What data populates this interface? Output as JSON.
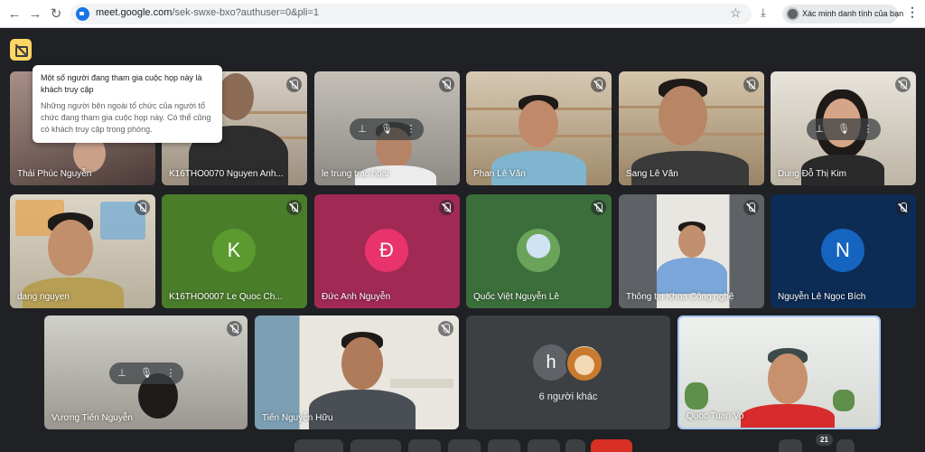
{
  "browser": {
    "url_domain": "meet.google.com",
    "url_path": "/sek-swxe-bxo?authuser=0&pli=1",
    "verify_label": "Xác minh danh tính của bạn",
    "back_icon": "←",
    "forward_icon": "→",
    "reload_icon": "↻",
    "star_icon": "☆",
    "download_icon": "⤓",
    "menu_icon": "⋮"
  },
  "tooltip": {
    "title": "Một số người đang tham gia cuộc họp này là khách truy cập",
    "body": "Những người bên ngoài tổ chức của người tổ chức đang tham gia cuộc họp này. Có thể cũng có khách truy cập trong phòng."
  },
  "participants": [
    {
      "name": "Thái Phúc Nguyễn"
    },
    {
      "name": "K16THO0070 Nguyen Anh..."
    },
    {
      "name": "le trung trac hoai"
    },
    {
      "name": "Phan Lê Văn"
    },
    {
      "name": "Sang Lê Văn"
    },
    {
      "name": "Dung Đỗ Thị Kim"
    },
    {
      "name": "dang nguyen"
    },
    {
      "name": "K16THO0007 Le Quoc Ch...",
      "initial": "K",
      "color": "#5a9a2e"
    },
    {
      "name": "Đức Anh Nguyễn",
      "initial": "Đ",
      "color": "#e8336d"
    },
    {
      "name": "Quốc Việt Nguyễn Lê"
    },
    {
      "name": "Thông tin Khoa Công nghệ"
    },
    {
      "name": "Nguyễn Lê Ngọc Bích",
      "initial": "N",
      "color": "#1565c0"
    },
    {
      "name": "Vương Tiến Nguyễn"
    },
    {
      "name": "Tiến Nguyễn Hữu"
    },
    {
      "name": "Quoc Tuan Vo"
    }
  ],
  "others": {
    "label": "6 người khác",
    "initial": "h",
    "initial_color": "#5f6368"
  },
  "overlay_controls": {
    "pin_icon": "⊥",
    "more_icon": "⋮"
  },
  "controls": {
    "participant_count": "21"
  },
  "colors": {
    "background": "#202124",
    "tile": "#3c4043",
    "tile_k": "#4a7d2a",
    "tile_d": "#a12a55",
    "tile_v": "#3b6e3a",
    "tile_n": "#0d2c55",
    "accent": "#fdd663"
  }
}
